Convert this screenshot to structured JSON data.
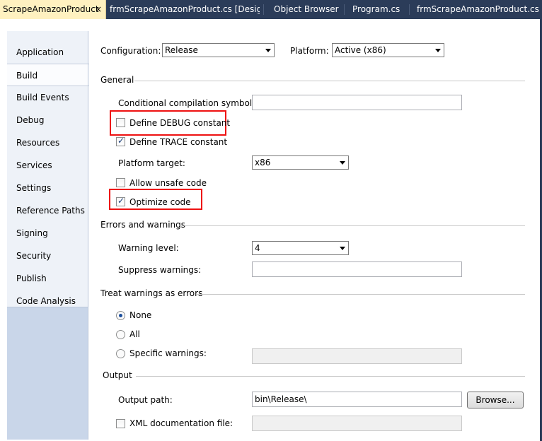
{
  "tabs": [
    {
      "label": "ScrapeAmazonProduct",
      "active": true
    },
    {
      "label": "frmScrapeAmazonProduct.cs [Design]",
      "active": false
    },
    {
      "label": "Object Browser",
      "active": false
    },
    {
      "label": "Program.cs",
      "active": false
    },
    {
      "label": "frmScrapeAmazonProduct.cs",
      "active": false
    }
  ],
  "tab_close_glyph": "×",
  "nav": {
    "items": [
      "Application",
      "Build",
      "Build Events",
      "Debug",
      "Resources",
      "Services",
      "Settings",
      "Reference Paths",
      "Signing",
      "Security",
      "Publish",
      "Code Analysis"
    ],
    "selected": "Build"
  },
  "config": {
    "configuration_label": "Configuration:",
    "configuration_value": "Release",
    "platform_label": "Platform:",
    "platform_value": "Active (x86)"
  },
  "general": {
    "heading": "General",
    "cond_symbols_label": "Conditional compilation symbols:",
    "cond_symbols_value": "",
    "define_debug_label": "Define DEBUG constant",
    "define_debug_checked": false,
    "define_trace_label": "Define TRACE constant",
    "define_trace_checked": true,
    "platform_target_label": "Platform target:",
    "platform_target_value": "x86",
    "allow_unsafe_label": "Allow unsafe code",
    "allow_unsafe_checked": false,
    "optimize_label": "Optimize code",
    "optimize_checked": true
  },
  "errors": {
    "heading": "Errors and warnings",
    "warning_level_label": "Warning level:",
    "warning_level_value": "4",
    "suppress_label": "Suppress warnings:",
    "suppress_value": ""
  },
  "treat": {
    "heading": "Treat warnings as errors",
    "none_label": "None",
    "all_label": "All",
    "specific_label": "Specific warnings:",
    "selected": "None",
    "specific_value": ""
  },
  "output": {
    "heading": "Output",
    "output_path_label": "Output path:",
    "output_path_value": "bin\\Release\\",
    "browse_label": "Browse...",
    "xml_doc_label": "XML documentation file:",
    "xml_doc_checked": false,
    "xml_doc_value": ""
  },
  "colors": {
    "highlight": "#ee1111",
    "tab_active": "#fff1c0",
    "tab_strip": "#2b3c59"
  }
}
